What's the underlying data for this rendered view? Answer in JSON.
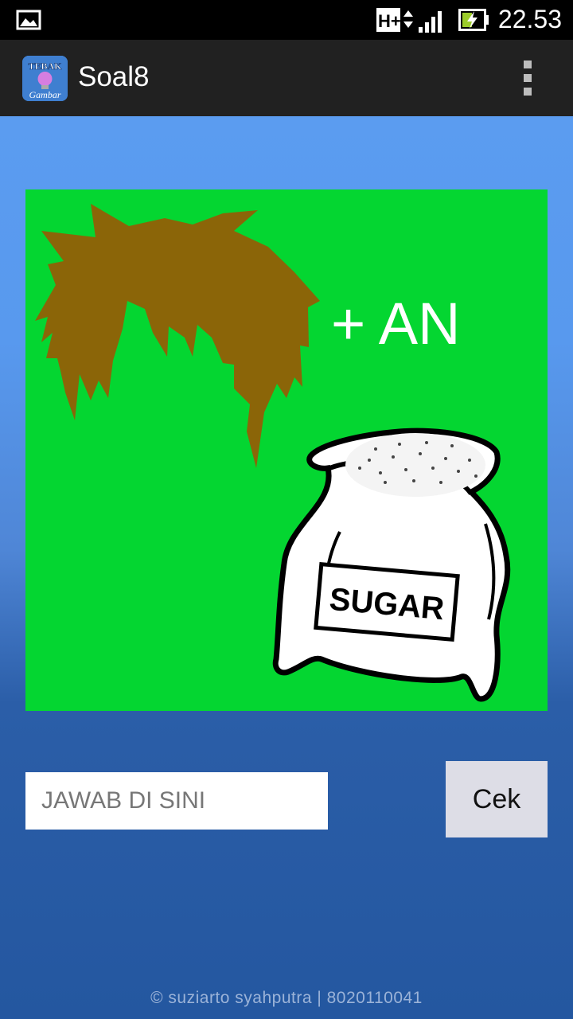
{
  "status_bar": {
    "time": "22.53",
    "network_type": "H+",
    "icons": [
      "image-notification-icon",
      "network-type-icon",
      "signal-icon",
      "battery-charging-icon"
    ]
  },
  "action_bar": {
    "title": "Soal8",
    "app_icon_text_top": "TEBAK",
    "app_icon_text_bottom": "Gambar"
  },
  "puzzle": {
    "hint_text": "+ AN",
    "sack_label": "SUGAR"
  },
  "answer": {
    "placeholder": "JAWAB DI SINI",
    "value": ""
  },
  "check_button": {
    "label": "Cek"
  },
  "footer": {
    "text": "© suziarto syahputra  |  8020110041"
  },
  "colors": {
    "status_bar": "#000000",
    "action_bar": "#212121",
    "image_background": "#04d631",
    "hair": "#8b6508",
    "button": "#dddde6"
  }
}
